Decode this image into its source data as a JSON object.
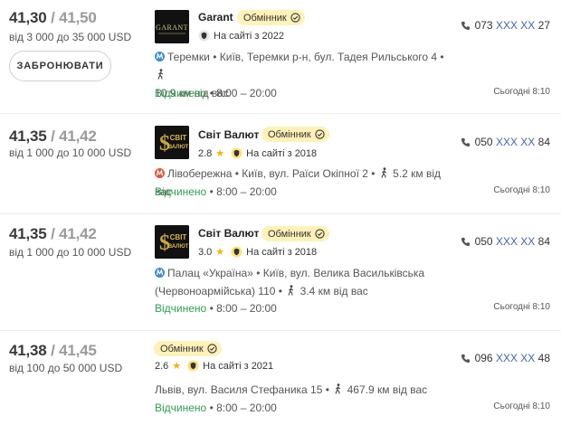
{
  "offers": [
    {
      "buy": "41,30",
      "sell": "41,50",
      "range": "від 3 000 до 35 000 USD",
      "book_label": "ЗАБРОНЮВАТИ",
      "name": "Garant",
      "badge": "Обмінник",
      "since": "На сайті з 2022",
      "metro": "Теремки",
      "address": "• Київ, Теремки р-н, бул. Тадея Рильського 4 •",
      "distance": "10.9 км від вас",
      "open": "Відчинено",
      "hours": "• 8:00 – 20:00",
      "phone_prefix": "073",
      "phone_masked": "XXX XX",
      "phone_suffix": "27",
      "updated": "Сьогодні 8:10"
    },
    {
      "buy": "41,35",
      "sell": "41,42",
      "range": "від 1 000 до 10 000 USD",
      "name": "Світ Валют",
      "badge": "Обмінник",
      "rating": "2.8",
      "since": "На сайті з 2018",
      "metro": "Лівобережна",
      "address": "• Київ, вул. Раїси Окіпної 2 •",
      "distance": "5.2 км від вас",
      "open": "Відчинено",
      "hours": "• 8:00 – 20:00",
      "phone_prefix": "050",
      "phone_masked": "XXX XX",
      "phone_suffix": "84",
      "updated": "Сьогодні 8:10"
    },
    {
      "buy": "41,35",
      "sell": "41,42",
      "range": "від 1 000 до 10 000 USD",
      "name": "Світ Валют",
      "badge": "Обмінник",
      "rating": "3.0",
      "since": "На сайті з 2018",
      "metro": "Палац «Україна»",
      "address": "• Київ, вул. Велика Васильківська (Червоноармійська) 110 •",
      "distance": "3.4 км від вас",
      "open": "Відчинено",
      "hours": "• 8:00 – 20:00",
      "phone_prefix": "050",
      "phone_masked": "XXX XX",
      "phone_suffix": "84",
      "updated": "Сьогодні 8:10"
    },
    {
      "buy": "41,38",
      "sell": "41,45",
      "range": "від 100 до 50 000 USD",
      "badge": "Обмінник",
      "rating": "2.6",
      "since": "На сайті з 2021",
      "address": "Львів, вул. Василя Стефаника 15 •",
      "distance": "467.9 км від вас",
      "open": "Відчинено",
      "hours": "• 8:00 – 20:00",
      "phone_prefix": "096",
      "phone_masked": "XXX XX",
      "phone_suffix": "48",
      "updated": "Сьогодні 8:10"
    }
  ],
  "colors": {
    "metro_blue": "#3d8ad6",
    "metro_red": "#e2533b",
    "open_green": "#2e9d4e",
    "badge_yellow": "#fff1b8",
    "phone_link": "#3f64b5",
    "star": "#f5b400"
  },
  "icons": {
    "logo_garant": "garant-logo",
    "logo_svit": "svit-valyut-logo",
    "verified": "check-circle-icon",
    "since": "shield-icon",
    "metro": "metro-m-icon",
    "walk": "walking-person-icon",
    "phone": "phone-icon",
    "rating": "star-icon"
  }
}
